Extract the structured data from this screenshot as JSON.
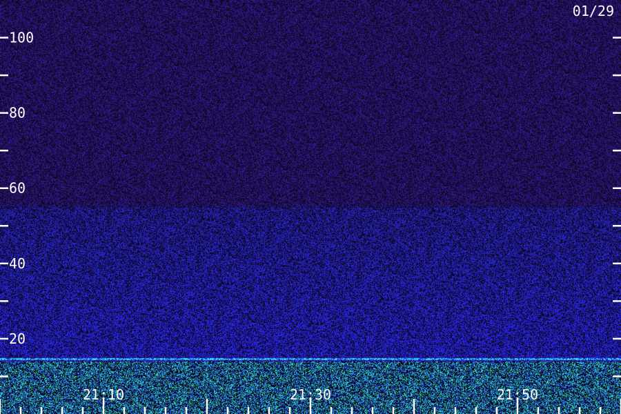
{
  "date_label": "01/29",
  "colors": {
    "background": "#0a0a2e",
    "noise_low": "#2a1068",
    "noise_mid": "#3a2fd0",
    "band_cyan": "#2fd6ff",
    "band_green": "#3cff7a",
    "axis": "#ffffff"
  },
  "chart_data": {
    "type": "heatmap",
    "title": "",
    "xlabel": "",
    "ylabel": "",
    "x_unit": "time (HH:MM)",
    "xlim": [
      "21:00",
      "21:59"
    ],
    "ylim": [
      0,
      110
    ],
    "y_ticks": [
      {
        "value": 10,
        "label": ""
      },
      {
        "value": 20,
        "label": "20"
      },
      {
        "value": 30,
        "label": ""
      },
      {
        "value": 40,
        "label": "40"
      },
      {
        "value": 50,
        "label": ""
      },
      {
        "value": 60,
        "label": "60"
      },
      {
        "value": 70,
        "label": ""
      },
      {
        "value": 80,
        "label": "80"
      },
      {
        "value": 90,
        "label": ""
      },
      {
        "value": 100,
        "label": "100"
      }
    ],
    "x_ticks": [
      {
        "value": "21:00",
        "label": ""
      },
      {
        "value": "21:10",
        "label": "21:10"
      },
      {
        "value": "21:20",
        "label": ""
      },
      {
        "value": "21:30",
        "label": "21:30"
      },
      {
        "value": "21:40",
        "label": ""
      },
      {
        "value": "21:50",
        "label": "21:50"
      }
    ],
    "intensity_regions": [
      {
        "y_from": 0,
        "y_to": 14,
        "level": "high",
        "note": "dense cyan/green band"
      },
      {
        "y_from": 14,
        "y_to": 15,
        "level": "line",
        "note": "thin bright line"
      },
      {
        "y_from": 15,
        "y_to": 55,
        "level": "medium",
        "note": "blue noise"
      },
      {
        "y_from": 55,
        "y_to": 110,
        "level": "low",
        "note": "purple noise"
      }
    ],
    "grid": false,
    "legend": "none"
  }
}
